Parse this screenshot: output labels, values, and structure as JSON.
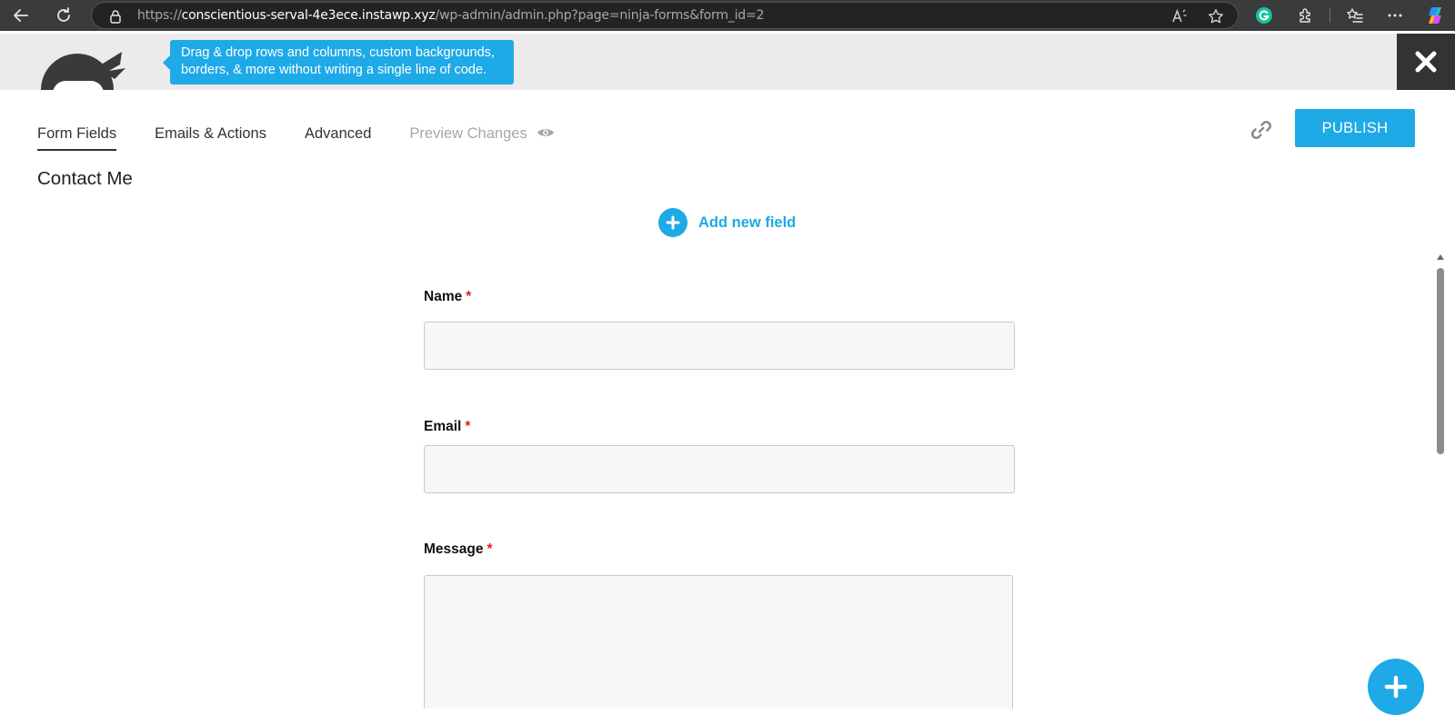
{
  "browser": {
    "url_prefix": "https://",
    "url_host": "conscientious-serval-4e3ece.instawp.xyz",
    "url_path": "/wp-admin/admin.php?page=ninja-forms&form_id=2"
  },
  "banner": {
    "tooltip_line1": "Drag & drop rows and columns, custom backgrounds,",
    "tooltip_line2": "borders, & more without writing a single line of code."
  },
  "tabs": [
    {
      "label": "Form Fields",
      "active": true
    },
    {
      "label": "Emails & Actions"
    },
    {
      "label": "Advanced"
    },
    {
      "label": "Preview Changes",
      "disabled": true
    }
  ],
  "toolbar": {
    "publish_label": "PUBLISH"
  },
  "form": {
    "title": "Contact Me",
    "add_field_label": "Add new field",
    "fields": [
      {
        "label": "Name",
        "required_mark": "*"
      },
      {
        "label": "Email",
        "required_mark": "*"
      },
      {
        "label": "Message",
        "required_mark": "*"
      }
    ]
  },
  "colors": {
    "accent": "#1ea9e7",
    "required": "#e02020"
  }
}
